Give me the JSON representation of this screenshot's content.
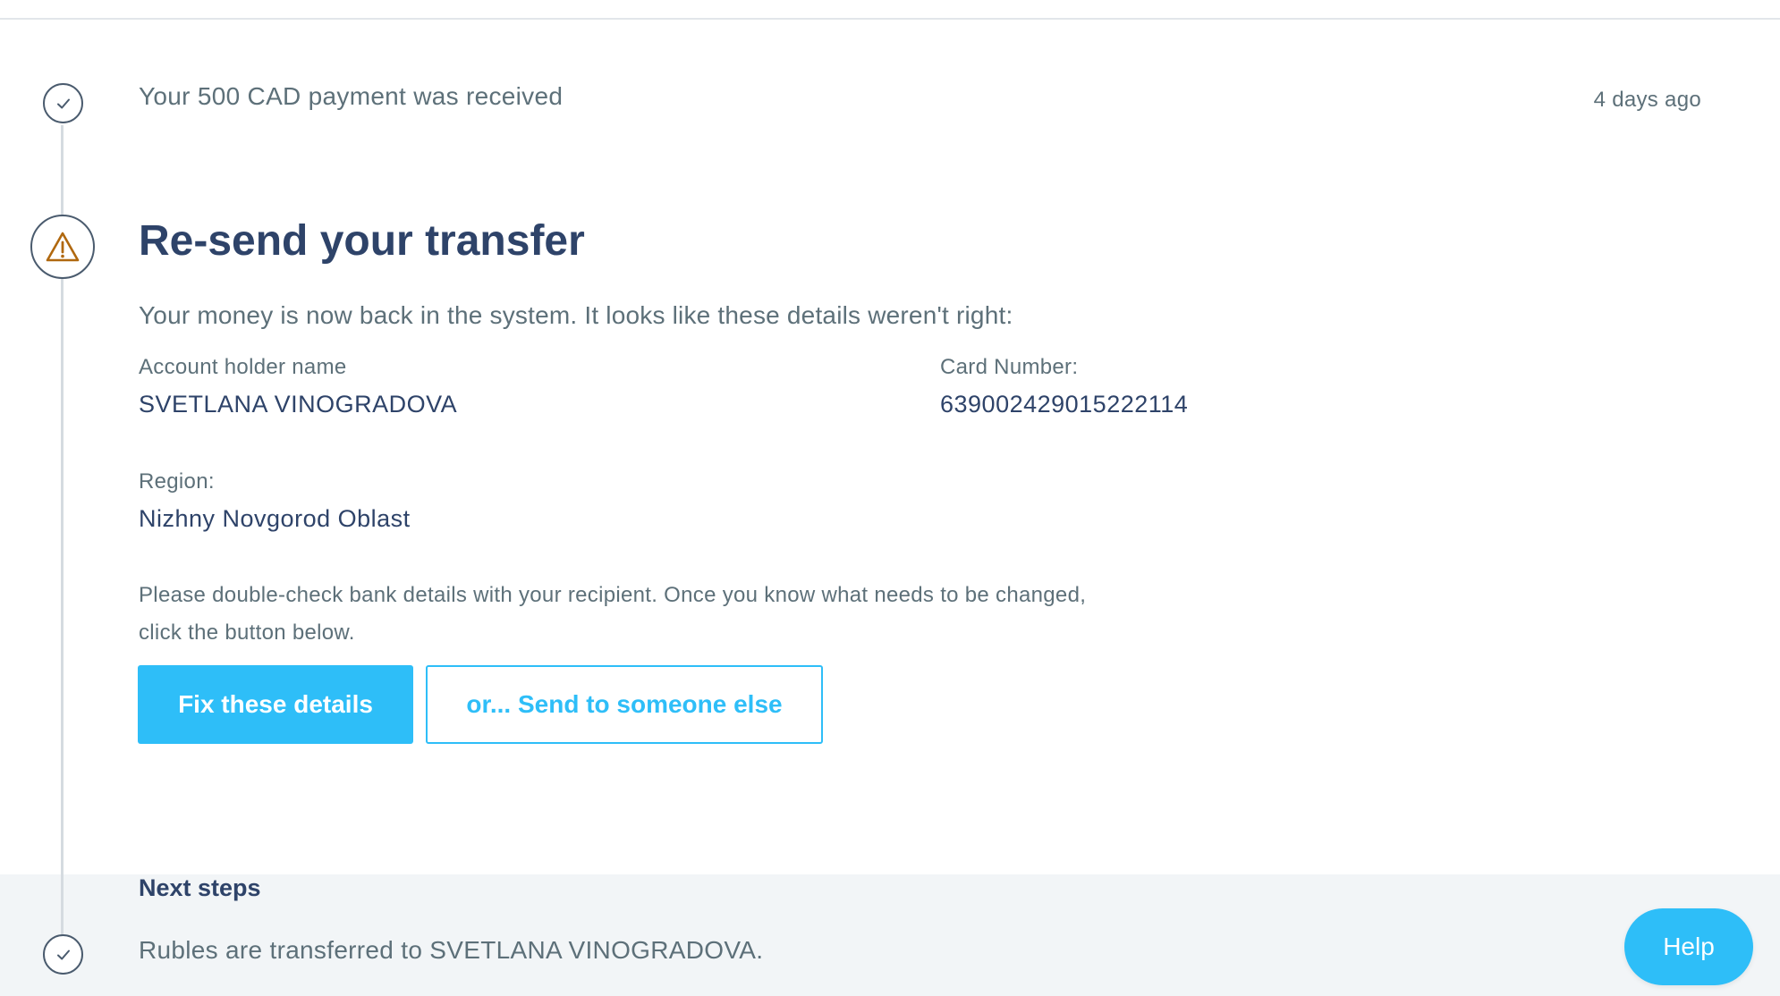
{
  "activity": {
    "received_message": "Your 500 CAD payment was received",
    "received_time": "4 days ago"
  },
  "resend": {
    "title": "Re-send your transfer",
    "subtitle": "Your money is now back in the system. It looks like these details weren't right:",
    "details": {
      "account_holder_label": "Account holder name",
      "account_holder_value": "SVETLANA VINOGRADOVA",
      "card_number_label": "Card Number:",
      "card_number_value": "639002429015222114",
      "region_label": "Region:",
      "region_value": "Nizhny Novgorod Oblast"
    },
    "instructions": "Please double-check bank details with your recipient. Once you know what needs to be changed, click the button below.",
    "primary_button": "Fix these details",
    "secondary_button": "or... Send to someone else"
  },
  "next_steps": {
    "heading": "Next steps",
    "item": "Rubles are transferred to SVETLANA VINOGRADOVA."
  },
  "help": {
    "label": "Help"
  },
  "icons": {
    "completed_step": "check-icon",
    "warning_step": "warning-icon"
  },
  "colors": {
    "accent": "#2ebef8",
    "heading": "#2e4369",
    "body_text": "#5d7079",
    "warning": "#b0680f",
    "panel_background": "#f2f5f7",
    "timeline": "#d5dbe0"
  }
}
